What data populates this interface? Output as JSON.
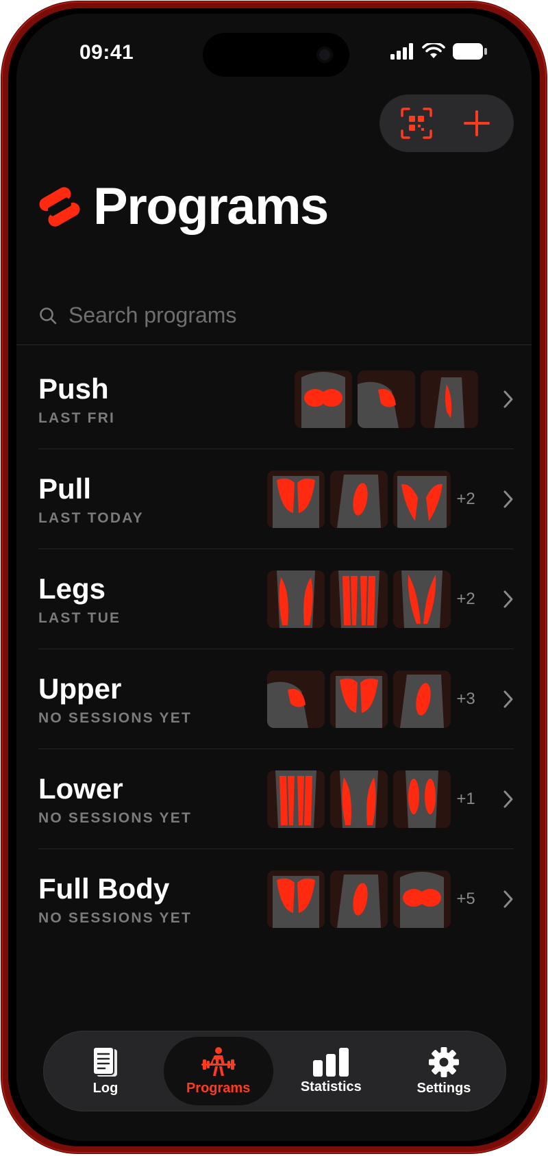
{
  "status_bar": {
    "time": "09:41"
  },
  "header": {
    "title": "Programs"
  },
  "search": {
    "placeholder": "Search programs",
    "value": ""
  },
  "colors": {
    "accent": "#ff3b1f",
    "background": "#0e0e0e",
    "muscle": "#ff2a10"
  },
  "programs": [
    {
      "name": "Push",
      "subtitle": "LAST FRI",
      "muscles": [
        "chest",
        "shoulders",
        "triceps"
      ],
      "more": ""
    },
    {
      "name": "Pull",
      "subtitle": "LAST TODAY",
      "muscles": [
        "back",
        "biceps",
        "lats"
      ],
      "more": "+2"
    },
    {
      "name": "Legs",
      "subtitle": "LAST TUE",
      "muscles": [
        "quads",
        "hamstrings",
        "adductors"
      ],
      "more": "+2"
    },
    {
      "name": "Upper",
      "subtitle": "NO SESSIONS YET",
      "muscles": [
        "shoulders",
        "back",
        "biceps"
      ],
      "more": "+3"
    },
    {
      "name": "Lower",
      "subtitle": "NO SESSIONS YET",
      "muscles": [
        "hamstrings",
        "quads",
        "calves"
      ],
      "more": "+1"
    },
    {
      "name": "Full Body",
      "subtitle": "NO SESSIONS YET",
      "muscles": [
        "back",
        "biceps",
        "chest"
      ],
      "more": "+5"
    }
  ],
  "tabs": [
    {
      "label": "Log",
      "icon": "notebook-icon",
      "active": false
    },
    {
      "label": "Programs",
      "icon": "weightlifter-icon",
      "active": true
    },
    {
      "label": "Statistics",
      "icon": "bar-chart-icon",
      "active": false
    },
    {
      "label": "Settings",
      "icon": "gear-icon",
      "active": false
    }
  ]
}
